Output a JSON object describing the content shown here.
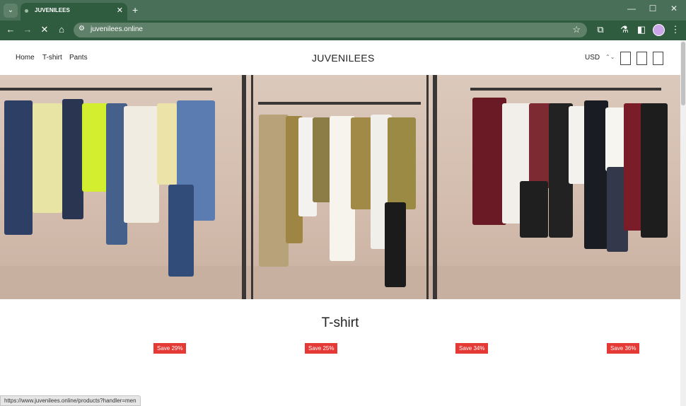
{
  "browser": {
    "tab_title": "JUVENILEES",
    "url": "juvenilees.online",
    "status_url": "https://www.juvenilees.online/products?handler=men"
  },
  "header": {
    "nav": [
      "Home",
      "T-shirt",
      "Pants"
    ],
    "brand": "JUVENILEES",
    "currency": "USD"
  },
  "section": {
    "title": "T-shirt",
    "badges": [
      "Save 29%",
      "Save 25%",
      "Save 34%",
      "Save 36%"
    ]
  },
  "colors": {
    "chrome_dark": "#2f5b3f",
    "chrome_light": "#4a6f58",
    "sale_badge": "#e53935"
  }
}
